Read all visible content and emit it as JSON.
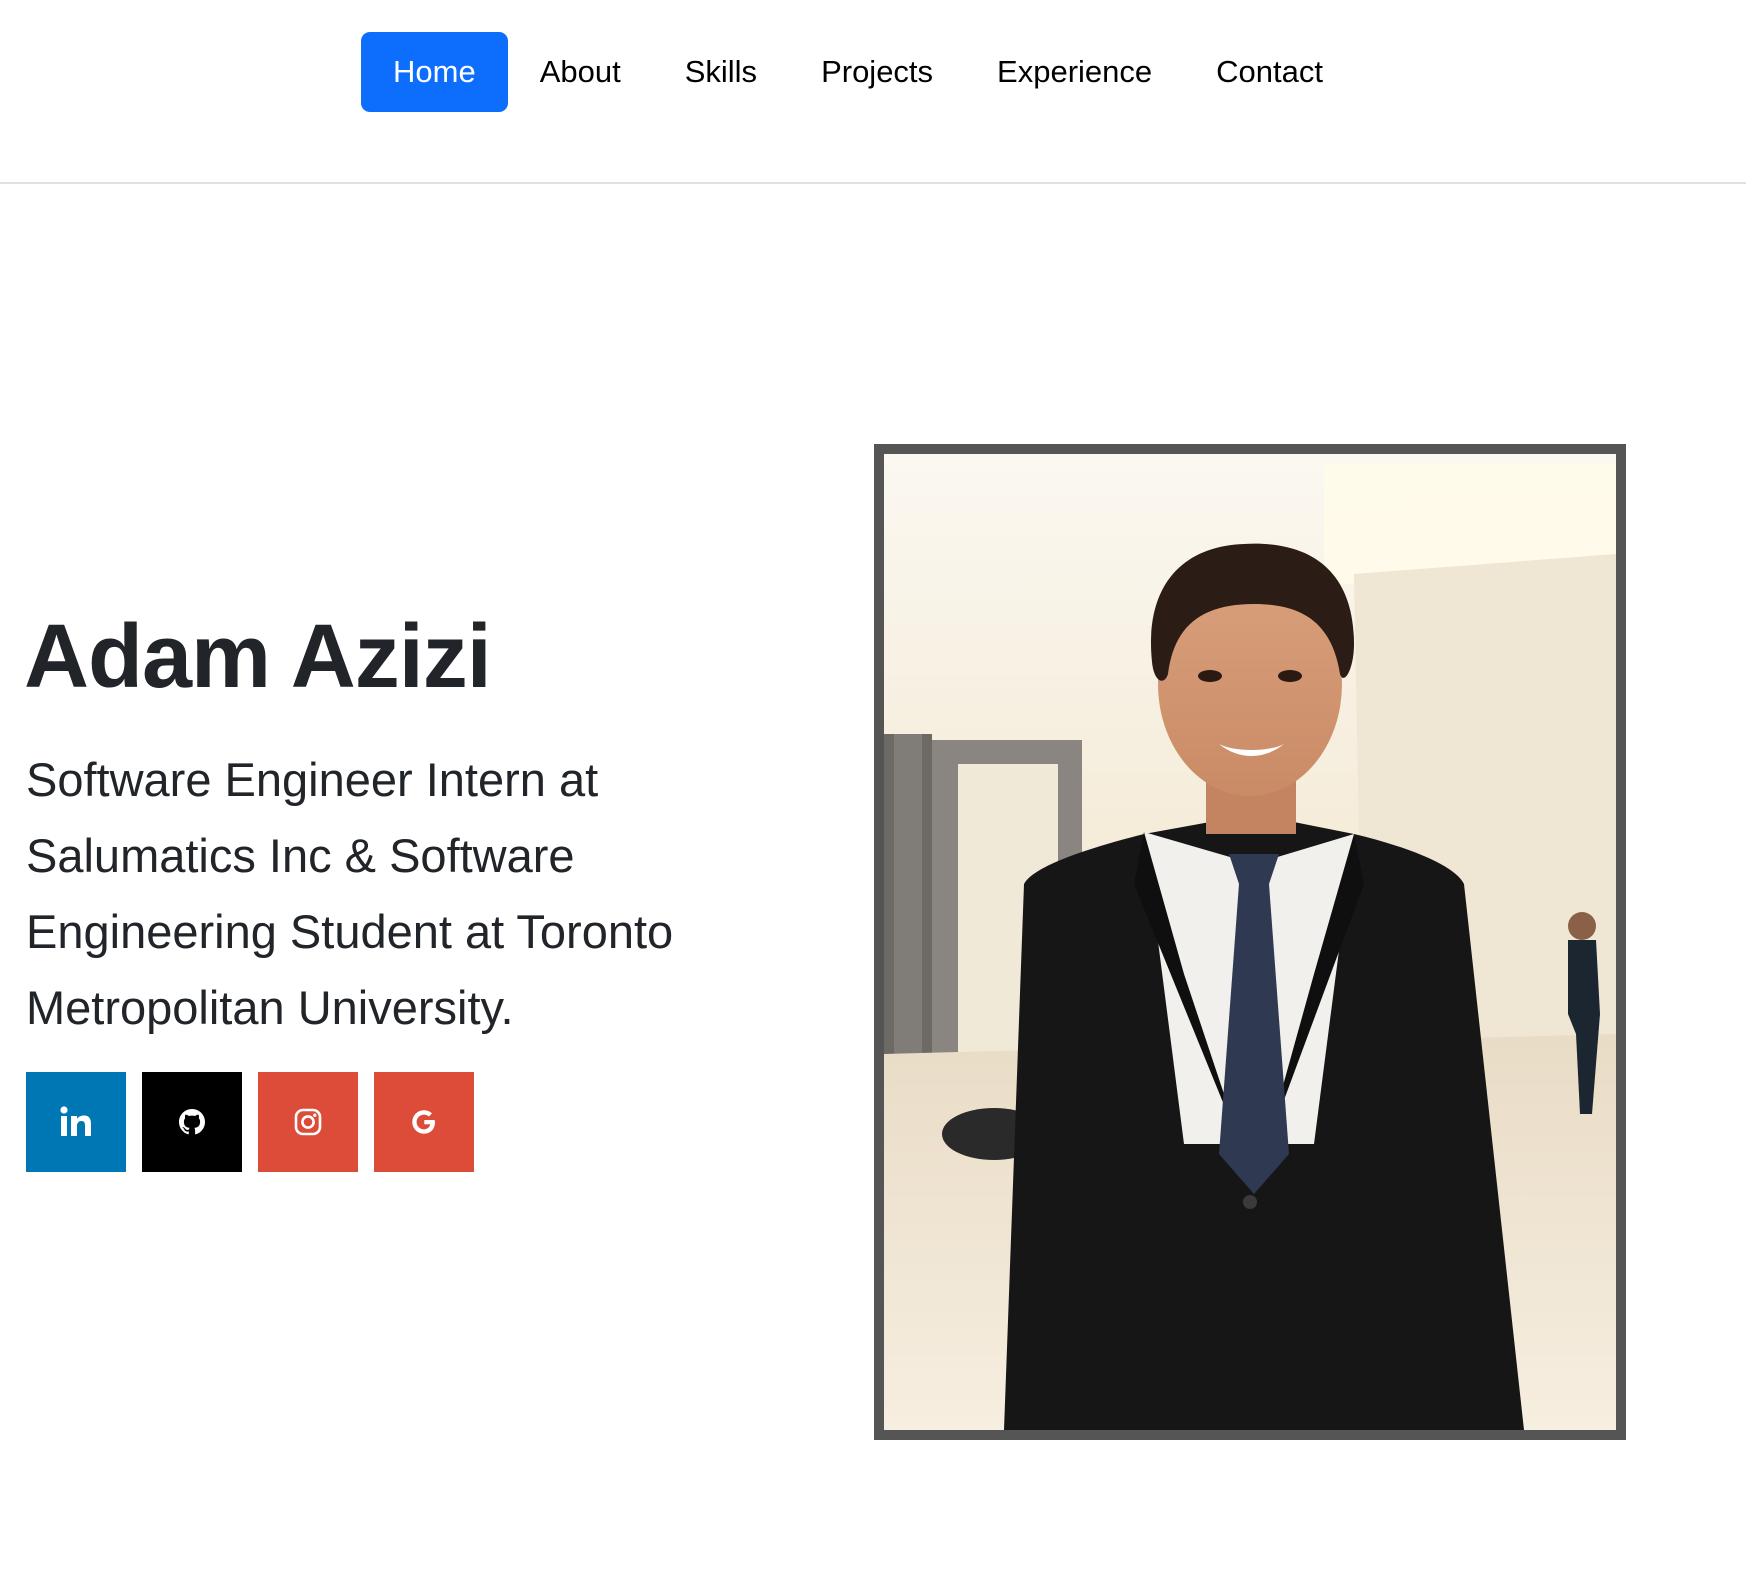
{
  "nav": {
    "items": [
      {
        "label": "Home",
        "active": true
      },
      {
        "label": "About",
        "active": false
      },
      {
        "label": "Skills",
        "active": false
      },
      {
        "label": "Projects",
        "active": false
      },
      {
        "label": "Experience",
        "active": false
      },
      {
        "label": "Contact",
        "active": false
      }
    ],
    "active_color": "#0d6efd"
  },
  "hero": {
    "name": "Adam Azizi",
    "subtitle": "Software Engineer Intern at Salumatics Inc & Software Engineering Student at Toronto Metropolitan University."
  },
  "social": [
    {
      "icon": "linkedin-icon",
      "color": "#0077b5"
    },
    {
      "icon": "github-icon",
      "color": "#000000"
    },
    {
      "icon": "instagram-icon",
      "color": "#dd4b39"
    },
    {
      "icon": "google-icon",
      "color": "#dd4b39"
    }
  ],
  "photo": {
    "frame_color": "#555555"
  }
}
